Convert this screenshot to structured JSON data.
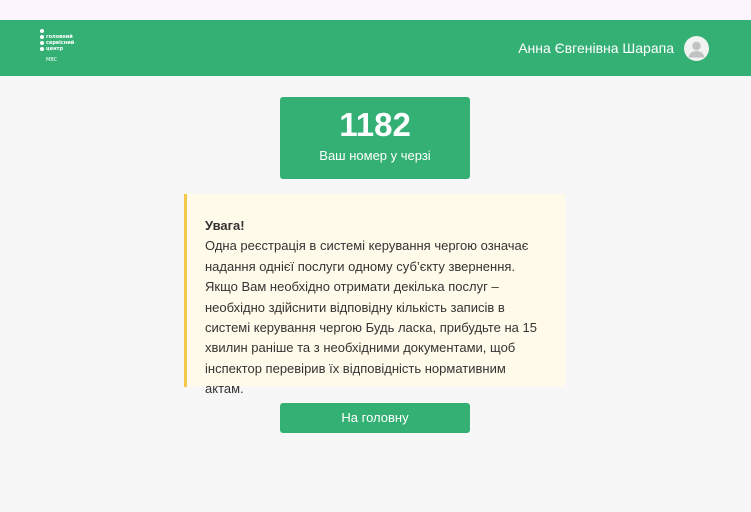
{
  "header": {
    "logo": {
      "lines": [
        "головний",
        "сервісний",
        "центр"
      ],
      "sub": "МВС"
    },
    "user_name": "Анна Євгенівна Шарапа",
    "avatar_icon": "user-avatar-icon"
  },
  "queue": {
    "number": "1182",
    "label": "Ваш номер у черзі"
  },
  "notice": {
    "title": "Увага!",
    "text": "Одна реєстрація в системі керування чергою означає надання однієї послуги одному суб’єкту звернення. Якщо Вам необхідно отримати декілька послуг – необхідно здійснити відповідну кількість записів в системі керування чергою Будь ласка, прибудьте на 15 хвилин раніше та з необхідними документами, щоб інспектор перевірив їх відповідність нормативним актам."
  },
  "actions": {
    "home_label": "На головну"
  },
  "colors": {
    "brand_green": "#34b075",
    "notice_background": "#fffaea",
    "notice_accent": "#f5c84c"
  }
}
